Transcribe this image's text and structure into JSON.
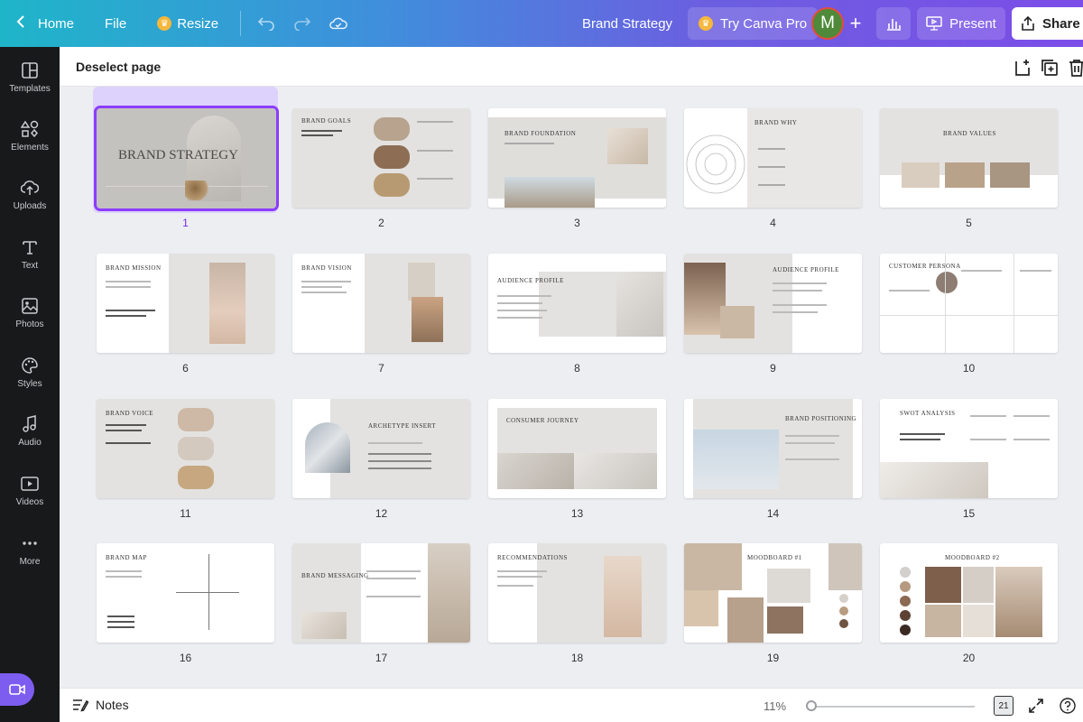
{
  "topbar": {
    "home_label": "Home",
    "file_label": "File",
    "resize_label": "Resize",
    "doc_title": "Brand Strategy",
    "pro_label": "Try Canva Pro",
    "avatar_initial": "M",
    "present_label": "Present",
    "share_label": "Share"
  },
  "sidebar": {
    "items": [
      {
        "label": "Templates",
        "icon": "templates-icon"
      },
      {
        "label": "Elements",
        "icon": "elements-icon"
      },
      {
        "label": "Uploads",
        "icon": "uploads-icon"
      },
      {
        "label": "Text",
        "icon": "text-icon"
      },
      {
        "label": "Photos",
        "icon": "photos-icon"
      },
      {
        "label": "Styles",
        "icon": "styles-icon"
      },
      {
        "label": "Audio",
        "icon": "audio-icon"
      },
      {
        "label": "Videos",
        "icon": "videos-icon"
      },
      {
        "label": "More",
        "icon": "more-icon"
      }
    ]
  },
  "subbar": {
    "deselect_label": "Deselect page"
  },
  "pages": [
    {
      "num": "1",
      "title": "BRAND STRATEGY",
      "selected": true
    },
    {
      "num": "2",
      "title": "BRAND GOALS"
    },
    {
      "num": "3",
      "title": "BRAND FOUNDATION"
    },
    {
      "num": "4",
      "title": "BRAND WHY"
    },
    {
      "num": "5",
      "title": "BRAND VALUES"
    },
    {
      "num": "6",
      "title": "BRAND MISSION"
    },
    {
      "num": "7",
      "title": "BRAND VISION"
    },
    {
      "num": "8",
      "title": "AUDIENCE PROFILE"
    },
    {
      "num": "9",
      "title": "AUDIENCE PROFILE"
    },
    {
      "num": "10",
      "title": "CUSTOMER PERSONA"
    },
    {
      "num": "11",
      "title": "BRAND VOICE"
    },
    {
      "num": "12",
      "title": "ARCHETYPE INSERT"
    },
    {
      "num": "13",
      "title": "CONSUMER JOURNEY"
    },
    {
      "num": "14",
      "title": "BRAND POSITIONING"
    },
    {
      "num": "15",
      "title": "SWOT ANALYSIS"
    },
    {
      "num": "16",
      "title": "BRAND MAP"
    },
    {
      "num": "17",
      "title": "BRAND MESSAGING"
    },
    {
      "num": "18",
      "title": "RECOMMENDATIONS"
    },
    {
      "num": "19",
      "title": "MOODBOARD #1"
    },
    {
      "num": "20",
      "title": "MOODBOARD #2"
    }
  ],
  "bottombar": {
    "notes_label": "Notes",
    "zoom": "11%",
    "page_count": "21"
  },
  "colors": {
    "accent": "#8b3dff",
    "sidebar_bg": "#18191b"
  }
}
